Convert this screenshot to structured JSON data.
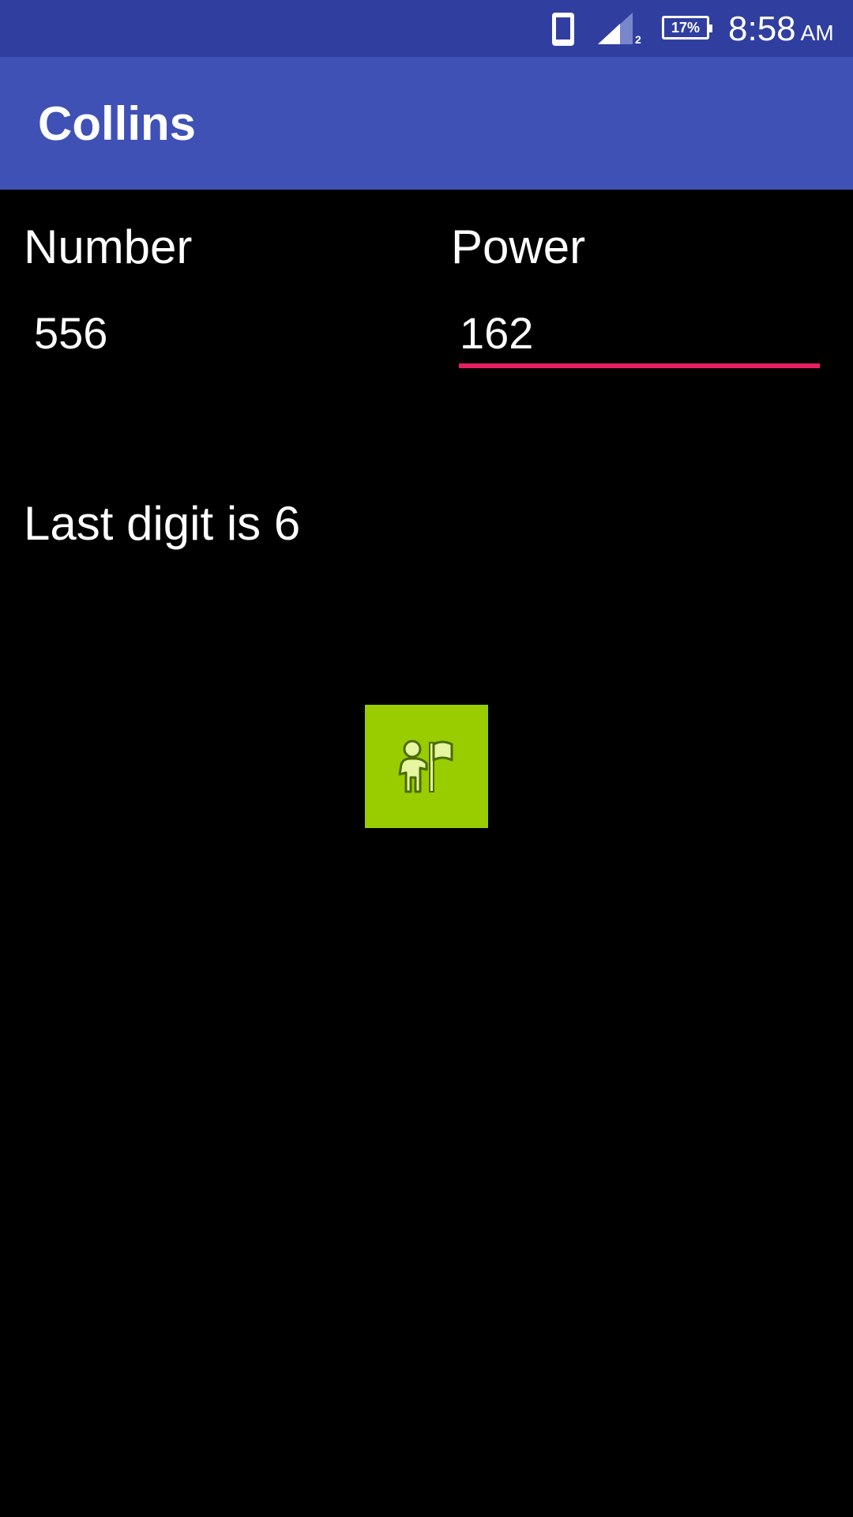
{
  "status_bar": {
    "sim_slot": "2",
    "battery": "17%",
    "time": "8:58",
    "ampm": "AM",
    "icons": [
      "phone-icon",
      "signal-icon",
      "battery-icon"
    ]
  },
  "app_bar": {
    "title": "Collins"
  },
  "form": {
    "number_label": "Number",
    "number_value": "556",
    "power_label": "Power",
    "power_value": "162"
  },
  "result": {
    "text": "Last digit is 6"
  },
  "action_button": {
    "icon": "person-flag-icon"
  },
  "colors": {
    "status_bar": "#303F9F",
    "app_bar": "#3F51B5",
    "accent": "#E91E63",
    "button": "#9ACD00",
    "background": "#000000"
  }
}
